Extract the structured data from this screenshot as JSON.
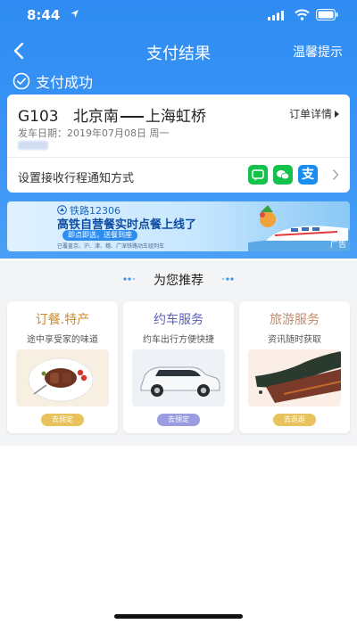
{
  "status_bar": {
    "time": "8:44"
  },
  "nav": {
    "title": "支付结果",
    "tip_label": "温馨提示"
  },
  "payment": {
    "status": "支付成功"
  },
  "order": {
    "train_no": "G103",
    "from": "北京南",
    "to": "上海虹桥",
    "detail_label": "订单详情",
    "depart_label": "发车日期：",
    "depart_date": "2019年07月08日",
    "weekday": "周一"
  },
  "notify": {
    "label": "设置接收行程通知方式",
    "alipay_glyph": "支"
  },
  "banner": {
    "brand": "铁路12306",
    "title": "高铁自营餐实时点餐上线了",
    "pill": "即点即选，送餐到座",
    "small_text": "已覆盖京、沪、津、穗、广深铁路动车组列车",
    "ad_tag": "广告"
  },
  "recommend": {
    "title": "为您推荐",
    "cards": [
      {
        "title": "订餐.特产",
        "subtitle": "途中享受家的味道",
        "button": "去预定",
        "title_color": "#c98a2a",
        "button_color": "#e8c25c"
      },
      {
        "title": "约车服务",
        "subtitle": "约车出行方便快捷",
        "button": "去预定",
        "title_color": "#5b5fb8",
        "button_color": "#9a9ce0"
      },
      {
        "title": "旅游服务",
        "subtitle": "资讯随时获取",
        "button": "去逛逛",
        "title_color": "#c48a6a",
        "button_color": "#e8c25c"
      }
    ]
  },
  "colors": {
    "header_blue": "#2f8cf2",
    "success_green": "#13c24a",
    "alipay_blue": "#1a8ef0"
  },
  "icons": [
    "location-arrow-icon",
    "signal-icon",
    "wifi-icon",
    "battery-icon",
    "back-arrow-icon",
    "check-circle-icon",
    "message-icon",
    "wechat-icon",
    "alipay-icon",
    "chevron-right-icon",
    "railway-logo-icon"
  ]
}
